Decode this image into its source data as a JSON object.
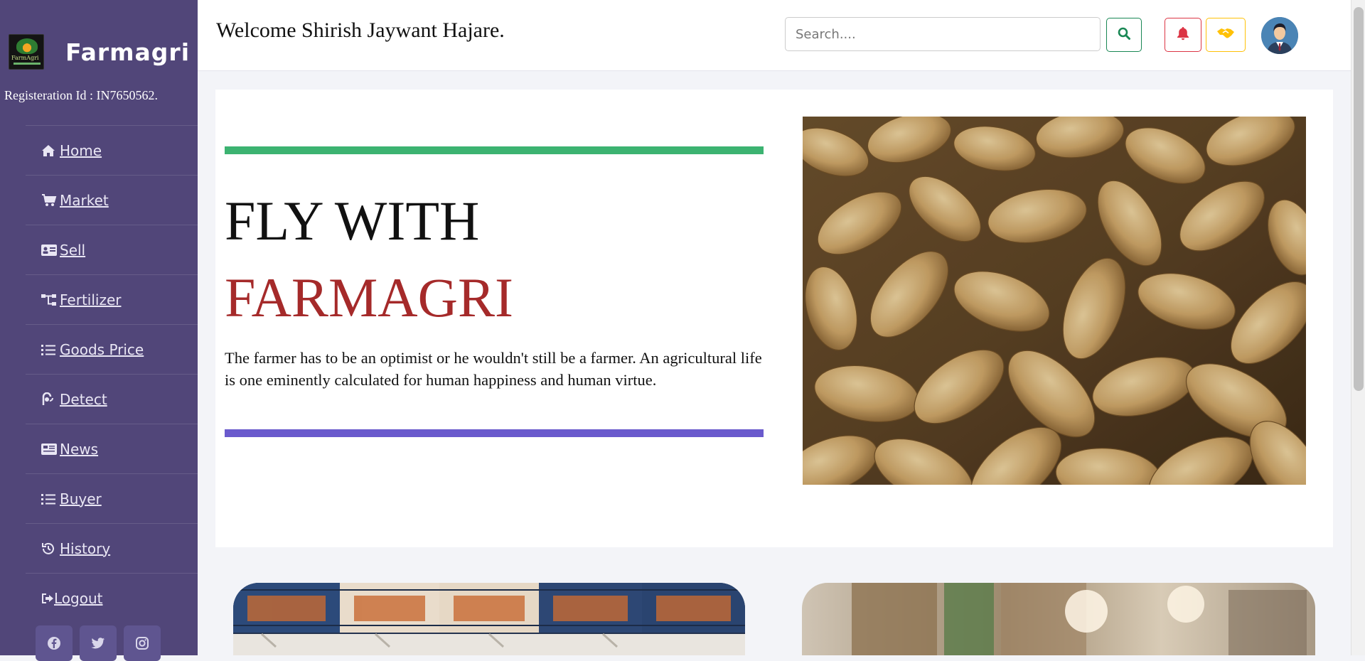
{
  "sidebar": {
    "brand": "Farmagri",
    "registration": "Registeration Id : IN7650562.",
    "items": [
      {
        "label": "Home",
        "icon": "home-icon"
      },
      {
        "label": "Market",
        "icon": "cart-icon"
      },
      {
        "label": "Sell",
        "icon": "id-card-icon"
      },
      {
        "label": "Fertilizer",
        "icon": "sitemap-icon"
      },
      {
        "label": "Goods Price",
        "icon": "list-icon"
      },
      {
        "label": "Detect",
        "icon": "detect-icon"
      },
      {
        "label": "News",
        "icon": "newspaper-icon"
      },
      {
        "label": "Buyer",
        "icon": "list-icon"
      },
      {
        "label": "History",
        "icon": "history-icon"
      },
      {
        "label": " Logout",
        "icon": "logout-icon"
      }
    ],
    "social": [
      "facebook-icon",
      "twitter-icon",
      "instagram-icon"
    ]
  },
  "header": {
    "welcome": "Welcome Shirish Jaywant Hajare.",
    "search_placeholder": "Search...."
  },
  "hero": {
    "line1": "FLY WITH",
    "line2": "FARMAGRI",
    "quote": "The farmer has to be an optimist or he wouldn't still be a farmer. An agricultural life is one eminently calculated for human happiness and human virtue."
  },
  "colors": {
    "sidebar": "#514679",
    "accent_green": "#3cb371",
    "accent_purple": "#6a5acd",
    "title_red": "#a52a2a"
  }
}
